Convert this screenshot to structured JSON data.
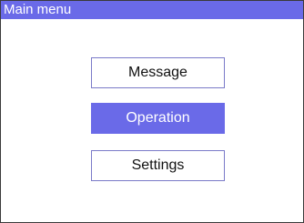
{
  "window": {
    "title": "Main menu"
  },
  "menu": {
    "items": [
      {
        "label": "Message",
        "selected": false
      },
      {
        "label": "Operation",
        "selected": true
      },
      {
        "label": "Settings",
        "selected": false
      }
    ]
  },
  "colors": {
    "accent": "#6a6ae8",
    "button_border": "#7a7ac8",
    "frame": "#3a3a3a",
    "background": "#ffffff"
  }
}
